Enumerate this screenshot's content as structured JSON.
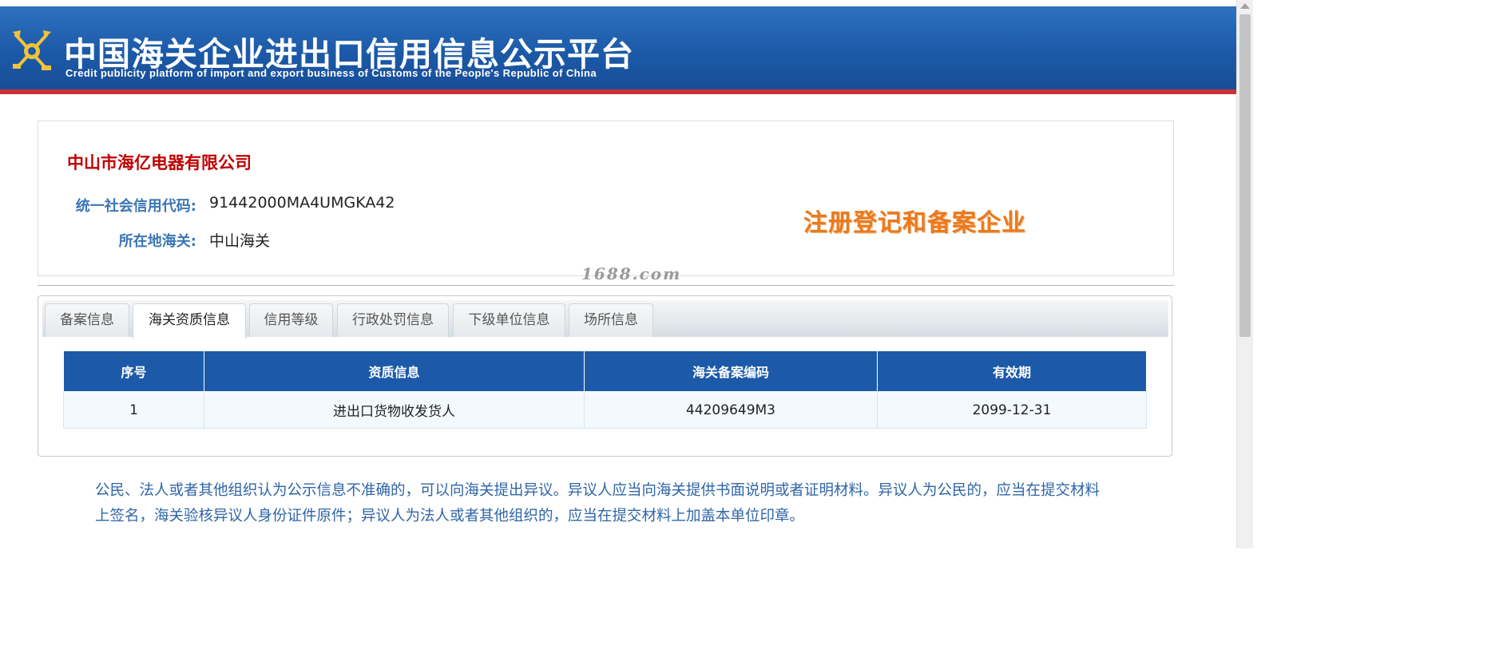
{
  "header": {
    "title_cn": "中国海关企业进出口信用信息公示平台",
    "title_en": "Credit publicity platform of import and export business of Customs of the People's Republic of China",
    "emblem_icon": "customs-emblem-icon",
    "bg_color": "#1b5aa8",
    "accent_line_color": "#c8303a"
  },
  "company": {
    "name": "中山市海亿电器有限公司",
    "credit_code_label": "统一社会信用代码:",
    "credit_code": "91442000MA4UMGKA42",
    "customs_label": "所在地海关:",
    "customs": "中山海关",
    "status_stamp": "注册登记和备案企业",
    "name_color": "#c00000",
    "stamp_color": "#ea7a1f"
  },
  "watermark": "1688.com",
  "tabs": [
    {
      "label": "备案信息",
      "active": false
    },
    {
      "label": "海关资质信息",
      "active": true
    },
    {
      "label": "信用等级",
      "active": false
    },
    {
      "label": "行政处罚信息",
      "active": false
    },
    {
      "label": "下级单位信息",
      "active": false
    },
    {
      "label": "场所信息",
      "active": false
    }
  ],
  "table": {
    "columns": [
      "序号",
      "资质信息",
      "海关备案编码",
      "有效期"
    ],
    "rows": [
      [
        "1",
        "进出口货物收发货人",
        "44209649M3",
        "2099-12-31"
      ]
    ],
    "header_color": "#1c5aa9"
  },
  "notice": "公民、法人或者其他组织认为公示信息不准确的，可以向海关提出异议。异议人应当向海关提供书面说明或者证明材料。异议人为公民的，应当在提交材料上签名，海关验核异议人身份证件原件；异议人为法人或者其他组织的，应当在提交材料上加盖本单位印章。"
}
